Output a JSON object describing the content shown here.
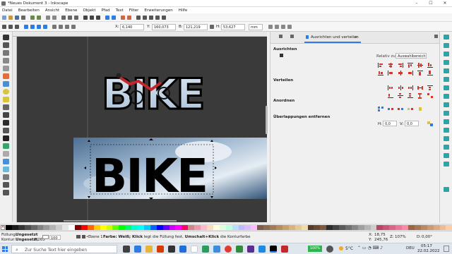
{
  "window": {
    "title": "*Neues Dokument 3 - Inkscape",
    "minimize": "–",
    "maximize": "☐",
    "close": "✕"
  },
  "menu": [
    "Datei",
    "Bearbeiten",
    "Ansicht",
    "Ebene",
    "Objekt",
    "Pfad",
    "Text",
    "Filter",
    "Erweiterungen",
    "Hilfe"
  ],
  "controls": {
    "x_label": "X:",
    "x_value": "6,140",
    "y_label": "Y:",
    "y_value": "160,073",
    "b_label": "B:",
    "b_value": "121,219",
    "h_label": "H:",
    "h_value": "53,627",
    "unit": "mm"
  },
  "canvas": {
    "text": "BIKE"
  },
  "panel": {
    "tabs": [
      {
        "label": "Ausrichten und verteilen",
        "close": "×"
      }
    ],
    "sections": {
      "align": "Ausrichten",
      "distribute": "Verteilen",
      "arrange": "Anordnen",
      "overlap": "Überlappungen entfernen"
    },
    "relative_label": "Relativ zu:",
    "relative_value": "Auswahlbereich",
    "overlap_h_label": "H:",
    "overlap_h_value": "0,0",
    "overlap_v_label": "V:",
    "overlap_v_value": "0,0"
  },
  "status": {
    "fill_label": "Füllung:",
    "fill_value": "Ungesetzt",
    "stroke_label": "Kontur:",
    "stroke_value": "Ungesetzt",
    "stroke_width": "0,265",
    "opacity": "100",
    "layer": "•Ebene 1",
    "message_bold1": "Farbe:",
    "message_bold2": "Weiß; Klick",
    "message_rest": "legt die Füllung fest,",
    "message_bold3": "Umschalt+Klick",
    "message_rest2": "die Konturfarbe",
    "coord_x_label": "X:",
    "coord_x": "18,75",
    "coord_y_label": "Y:",
    "coord_y": "245,76",
    "zoom_label": "Z:",
    "zoom": "107%",
    "rotation_label": "D:",
    "rotation": "0,00°"
  },
  "taskbar": {
    "search_placeholder": "Zur Suche Text hier eingeben",
    "battery": "100%",
    "weather": "5°C",
    "language": "DEU",
    "time": "05:17",
    "date": "22.02.2022"
  },
  "colors": {
    "accent": "#2d7be5",
    "canvas_bg": "#3a3a3a",
    "sky_light": "#c7d7e8",
    "sky_dark": "#35577d"
  }
}
